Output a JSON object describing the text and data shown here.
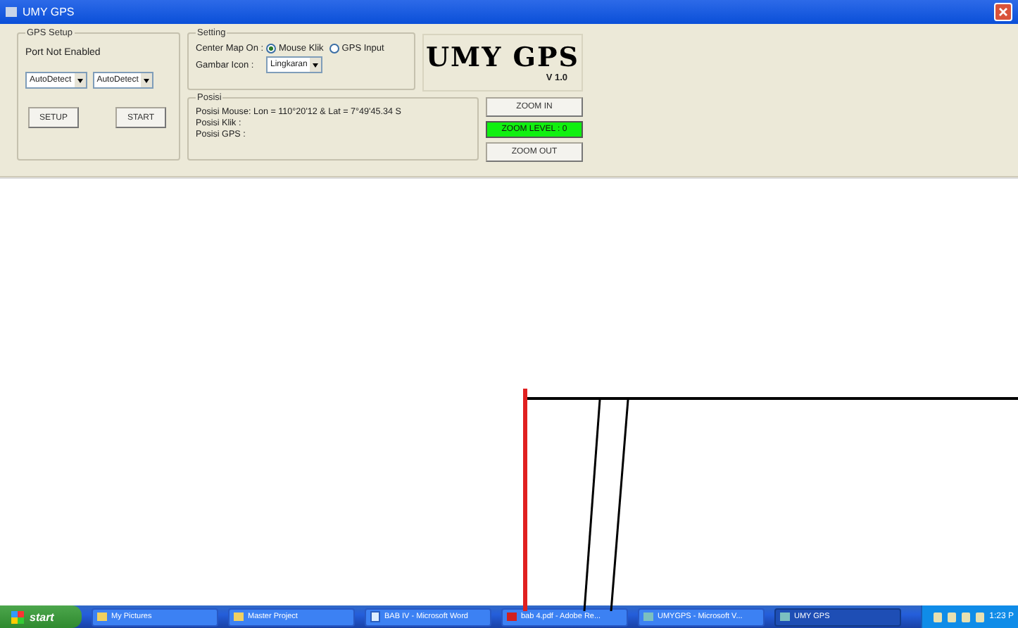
{
  "window": {
    "title": "UMY GPS"
  },
  "gps_setup": {
    "title": "GPS Setup",
    "status": "Port Not Enabled",
    "combos": [
      "AutoDetect",
      "AutoDetect"
    ],
    "buttons": [
      "SETUP",
      "START"
    ]
  },
  "setting": {
    "title": "Setting",
    "center_label": "Center Map On :",
    "radios": [
      {
        "label": "Mouse Klik",
        "selected": true
      },
      {
        "label": "GPS Input",
        "selected": false
      }
    ],
    "icon_label": "Gambar Icon :",
    "icon_combo": "Lingkaran"
  },
  "logo": {
    "name": "UMY GPS",
    "version": "V 1.0"
  },
  "posisi": {
    "title": "Posisi",
    "lines": [
      "Posisi Mouse: Lon = 110°20'12 & Lat = 7°49'45.34 S",
      "Posisi Klik :",
      "Posisi GPS :"
    ]
  },
  "zoom": {
    "zoom_in": "ZOOM IN",
    "level_label": "ZOOM LEVEL : 0",
    "zoom_out": "ZOOM OUT"
  },
  "taskbar": {
    "start": "start",
    "items": [
      {
        "label": "My Pictures",
        "kind": "folder",
        "selected": false
      },
      {
        "label": "Master Project",
        "kind": "folder",
        "selected": false
      },
      {
        "label": "BAB IV - Microsoft Word",
        "kind": "doc",
        "selected": false
      },
      {
        "label": "bab 4.pdf - Adobe Re...",
        "kind": "pdf",
        "selected": false
      },
      {
        "label": "UMYGPS - Microsoft V...",
        "kind": "app",
        "selected": false
      },
      {
        "label": "UMY GPS",
        "kind": "app",
        "selected": true
      }
    ],
    "clock": "1:23 P"
  }
}
